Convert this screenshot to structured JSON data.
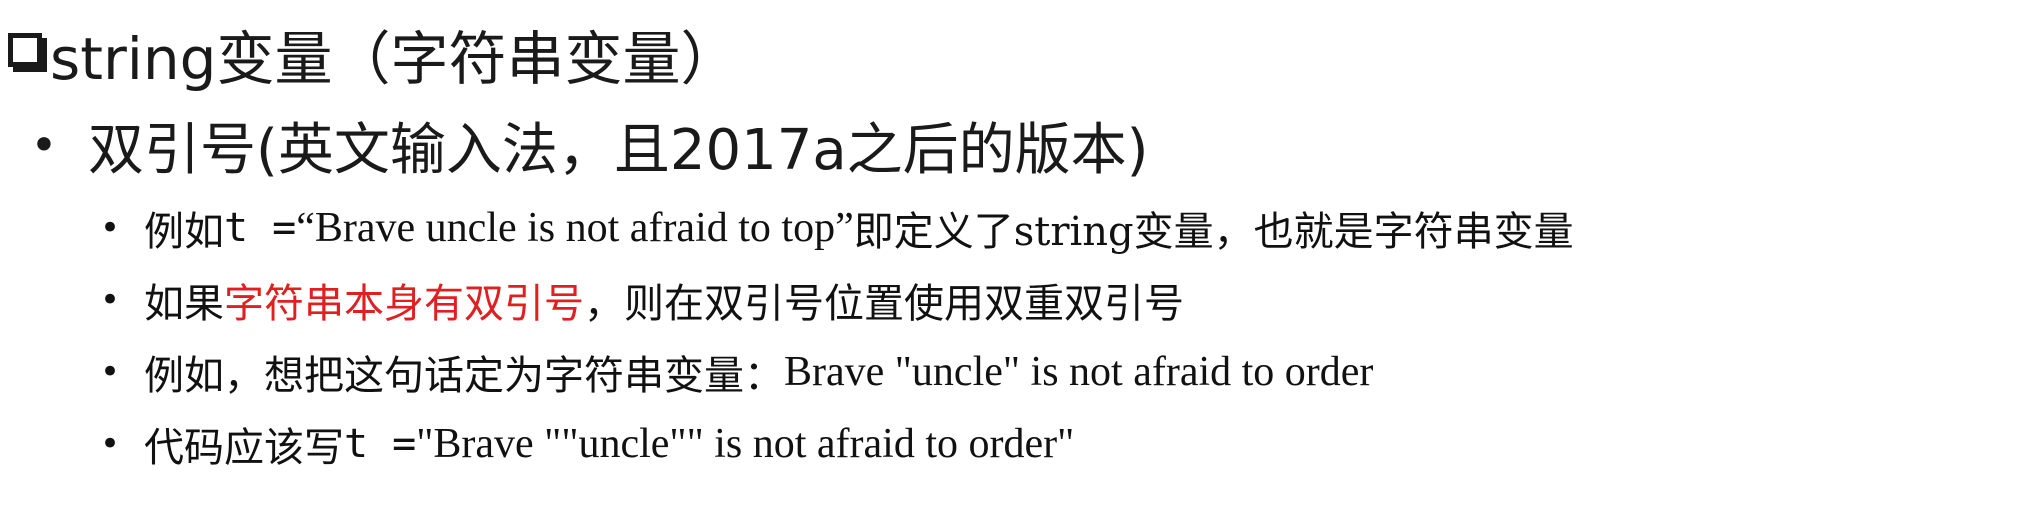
{
  "title": {
    "icon": "checkbox-bullet-icon",
    "text": "string变量（字符串变量）"
  },
  "point": {
    "text": "双引号(英文输入法，且2017a之后的版本)"
  },
  "items": [
    {
      "prefix": "例如",
      "code": "t = ",
      "quote": "“Brave uncle is not afraid to top”",
      "suffix": "  即定义了string变量，也就是字符串变量"
    },
    {
      "prefix": "如果",
      "highlight": "字符串本身有双引号",
      "suffix": "，则在双引号位置使用双重双引号"
    },
    {
      "prefix": "例如，想把这句话定为字符串变量：",
      "quote": " Brave \"uncle\" is not afraid to order"
    },
    {
      "prefix": "代码应该写 ",
      "code": "t = ",
      "quote": "\"Brave \"\"uncle\"\" is not afraid to order\""
    }
  ],
  "colors": {
    "highlight": "#e02020",
    "text": "#111111"
  }
}
